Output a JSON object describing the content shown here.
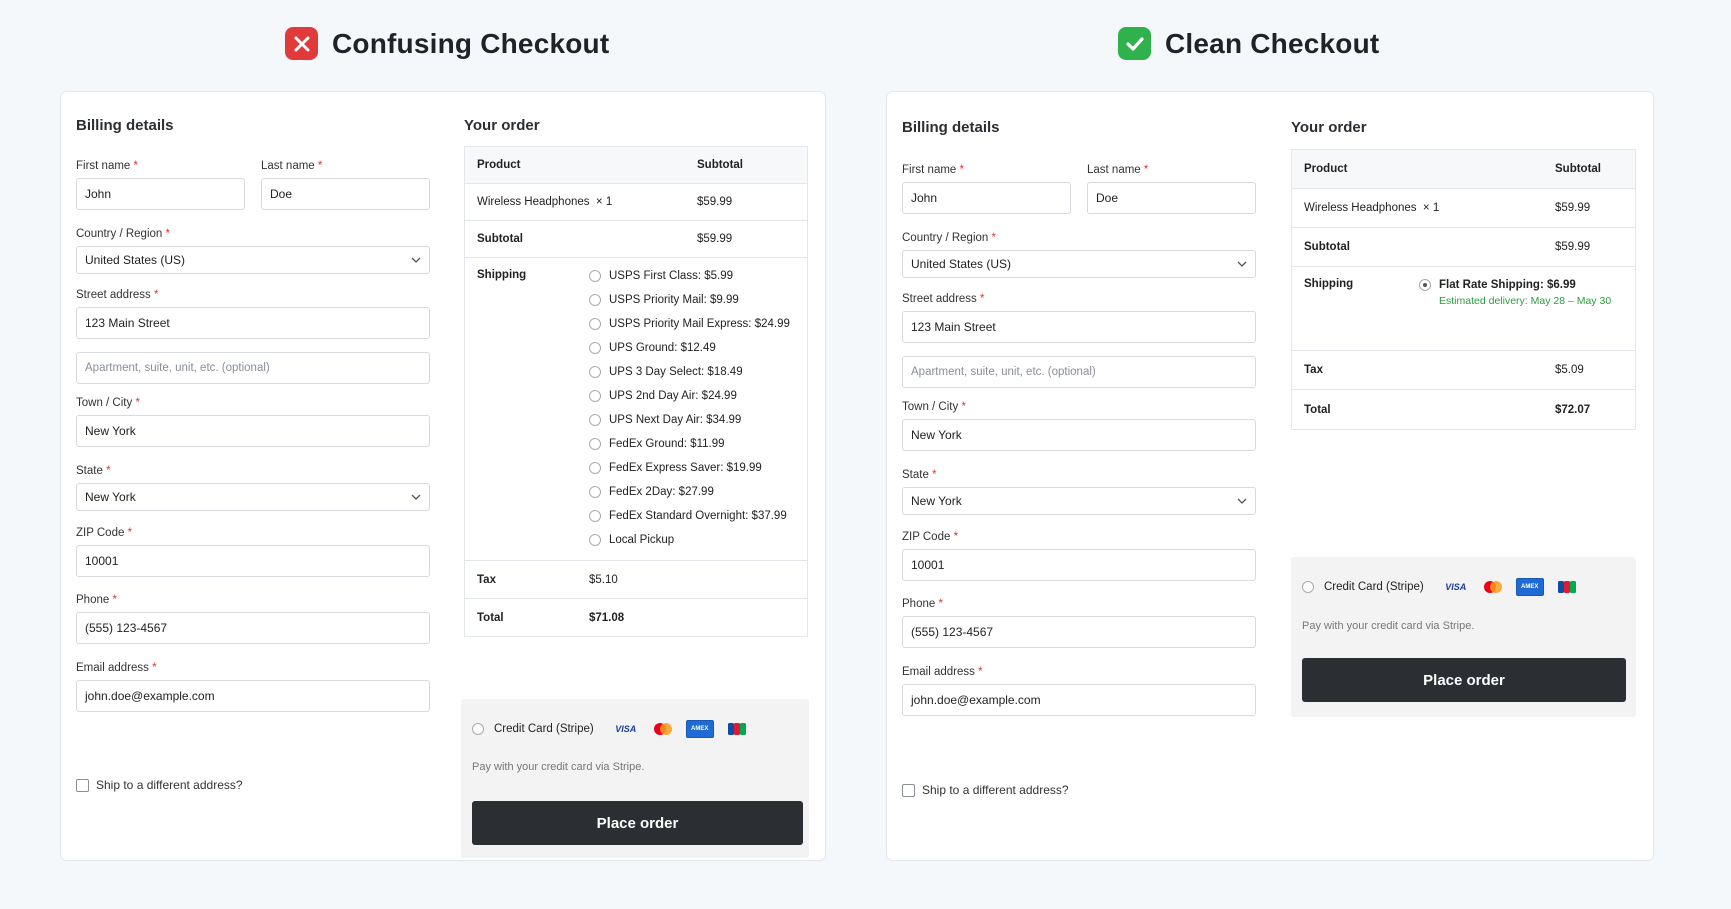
{
  "colors": {
    "bad": "#e03a3a",
    "good": "#2fb24c",
    "button": "#2b2e33",
    "required": "#dd3333",
    "delivery": "#2a9d3f"
  },
  "left": {
    "title": "Confusing Checkout",
    "status_icon": "x-icon",
    "billing": {
      "title": "Billing details",
      "first_name_label": "First name",
      "first_name": "John",
      "last_name_label": "Last name",
      "last_name": "Doe",
      "country_label": "Country / Region",
      "country": "United States (US)",
      "street_label": "Street address",
      "street": "123 Main Street",
      "apt_placeholder": "Apartment, suite, unit, etc. (optional)",
      "city_label": "Town / City",
      "city": "New York",
      "state_label": "State",
      "state": "New York",
      "zip_label": "ZIP Code",
      "zip": "10001",
      "phone_label": "Phone",
      "phone": "(555) 123-4567",
      "email_label": "Email address",
      "email": "john.doe@example.com",
      "ship_different": "Ship to a different address?"
    },
    "order": {
      "title": "Your order",
      "col_product": "Product",
      "col_subtotal": "Subtotal",
      "item": "Wireless Headphones",
      "qty": "× 1",
      "item_price": "$59.99",
      "subtotal_label": "Subtotal",
      "subtotal": "$59.99",
      "shipping_label": "Shipping",
      "shipping_options": [
        "USPS First Class: $5.99",
        "USPS Priority Mail: $9.99",
        "USPS Priority Mail Express: $24.99",
        "UPS Ground: $12.49",
        "UPS 3 Day Select: $18.49",
        "UPS 2nd Day Air: $24.99",
        "UPS Next Day Air: $34.99",
        "FedEx Ground: $11.99",
        "FedEx Express Saver: $19.99",
        "FedEx 2Day: $27.99",
        "FedEx Standard Overnight: $37.99",
        "Local Pickup"
      ],
      "tax_label": "Tax",
      "tax": "$5.10",
      "total_label": "Total",
      "total": "$71.08"
    },
    "payment": {
      "method": "Credit Card (Stripe)",
      "note": "Pay with your credit card via Stripe.",
      "cards": [
        "VISA",
        "mastercard",
        "AMEX",
        "JCB"
      ],
      "button": "Place order"
    }
  },
  "right": {
    "title": "Clean Checkout",
    "status_icon": "check-icon",
    "billing": {
      "title": "Billing details",
      "first_name_label": "First name",
      "first_name": "John",
      "last_name_label": "Last name",
      "last_name": "Doe",
      "country_label": "Country / Region",
      "country": "United States (US)",
      "street_label": "Street address",
      "street": "123 Main Street",
      "apt_placeholder": "Apartment, suite, unit, etc. (optional)",
      "city_label": "Town / City",
      "city": "New York",
      "state_label": "State",
      "state": "New York",
      "zip_label": "ZIP Code",
      "zip": "10001",
      "phone_label": "Phone",
      "phone": "(555) 123-4567",
      "email_label": "Email address",
      "email": "john.doe@example.com",
      "ship_different": "Ship to a different address?"
    },
    "order": {
      "title": "Your order",
      "col_product": "Product",
      "col_subtotal": "Subtotal",
      "item": "Wireless Headphones",
      "qty": "× 1",
      "item_price": "$59.99",
      "subtotal_label": "Subtotal",
      "subtotal": "$59.99",
      "shipping_label": "Shipping",
      "shipping_option": "Flat Rate Shipping: $6.99",
      "delivery": "Estimated delivery: May 28 – May 30",
      "tax_label": "Tax",
      "tax": "$5.09",
      "total_label": "Total",
      "total": "$72.07"
    },
    "payment": {
      "method": "Credit Card (Stripe)",
      "note": "Pay with your credit card via Stripe.",
      "cards": [
        "VISA",
        "mastercard",
        "AMEX",
        "JCB"
      ],
      "button": "Place order"
    }
  }
}
